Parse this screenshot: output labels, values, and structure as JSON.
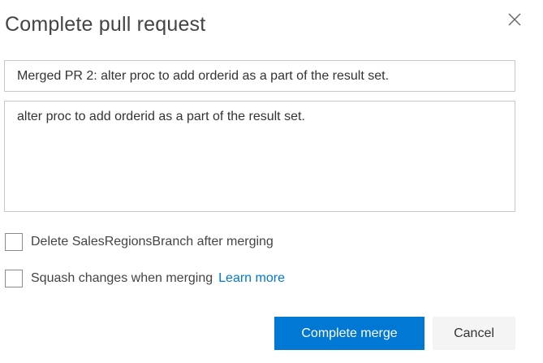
{
  "dialog": {
    "title": "Complete pull request",
    "close_icon": "close-icon"
  },
  "form": {
    "title_value": "Merged PR 2: alter proc to add orderid as a part of the result set.",
    "description_value": "alter proc to add orderid as a part of the result set."
  },
  "options": {
    "delete_branch_label": "Delete SalesRegionsBranch after merging",
    "delete_branch_checked": false,
    "squash_label": "Squash changes when merging",
    "squash_checked": false,
    "learn_more_label": "Learn more"
  },
  "buttons": {
    "complete_label": "Complete merge",
    "cancel_label": "Cancel"
  },
  "colors": {
    "accent": "#0078d4",
    "secondary_button": "#f4f4f4",
    "border": "#c8c8c8"
  }
}
